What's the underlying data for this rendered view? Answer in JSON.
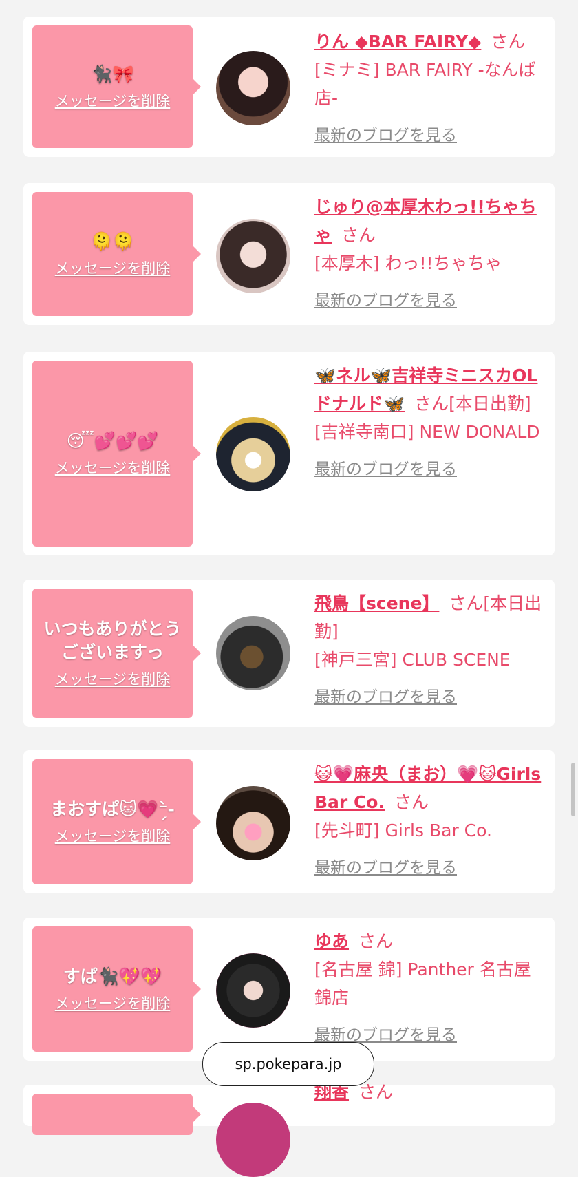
{
  "cards": [
    {
      "message": "🐈‍⬛🎀",
      "delete_label": "メッセージを削除",
      "name": "りん ◆BAR FAIRY◆",
      "suffix": "さん",
      "shop": "[ミナミ] BAR FAIRY -なんば店-",
      "blog_label": "最新のブログを見る"
    },
    {
      "message": "🫠🫠",
      "delete_label": "メッセージを削除",
      "name": "じゅり@本厚木わっ!!ちゃちゃ",
      "suffix": "さん",
      "shop": "[本厚木] わっ!!ちゃちゃ",
      "blog_label": "最新のブログを見る"
    },
    {
      "message": "😴💕💕💕",
      "delete_label": "メッセージを削除",
      "name": "🦋ネル🦋吉祥寺ミニスカOLドナルド🦋",
      "suffix": "さん[本日出勤]",
      "shop": "[吉祥寺南口] NEW DONALD",
      "blog_label": "最新のブログを見る"
    },
    {
      "message": "いつもありがとうございますっ",
      "delete_label": "メッセージを削除",
      "name": "飛鳥【scene】",
      "suffix": "さん[本日出勤]",
      "shop": "[神戸三宮] CLUB SCENE",
      "blog_label": "最新のブログを見る"
    },
    {
      "message": "まおすぱ🐱💗⁻̗̀-",
      "delete_label": "メッセージを削除",
      "name": "😺💗麻央（まお）💗😺Girls Bar Co.",
      "suffix": "さん",
      "shop": "[先斗町] Girls Bar Co.",
      "blog_label": "最新のブログを見る"
    },
    {
      "message": "すぱ🐈‍⬛💖💖",
      "delete_label": "メッセージを削除",
      "name": "ゆあ",
      "suffix": "さん",
      "shop": "[名古屋 錦] Panther 名古屋錦店",
      "blog_label": "最新のブログを見る"
    },
    {
      "message": "",
      "delete_label": "",
      "name": "翔香",
      "suffix": "さん",
      "shop": "",
      "blog_label": ""
    }
  ],
  "url_bar": {
    "domain": "sp.pokepara.jp"
  },
  "colors": {
    "accent": "#e8365b",
    "bubble": "#fb97a8"
  }
}
